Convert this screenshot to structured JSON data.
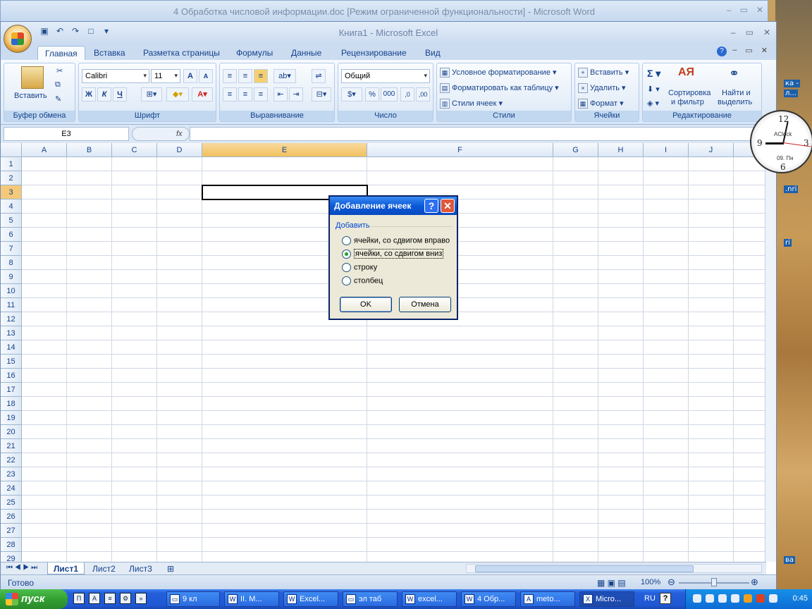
{
  "word": {
    "title": "4 Обработка числовой информации.doc [Режим ограниченной функциональности] - Microsoft Word"
  },
  "excel": {
    "title": "Книга1 - Microsoft Excel"
  },
  "tabs": [
    "Главная",
    "Вставка",
    "Разметка страницы",
    "Формулы",
    "Данные",
    "Рецензирование",
    "Вид"
  ],
  "ribbon": {
    "clipboard": {
      "label": "Буфер обмена",
      "paste": "Вставить"
    },
    "font": {
      "label": "Шрифт",
      "name": "Calibri",
      "size": "11",
      "bold": "Ж",
      "italic": "К",
      "underline": "Ч"
    },
    "align": {
      "label": "Выравнивание"
    },
    "number": {
      "label": "Число",
      "format": "Общий",
      "percent": "%",
      "thousands": "000"
    },
    "styles": {
      "label": "Стили",
      "cond": "Условное форматирование",
      "table": "Форматировать как таблицу",
      "cell": "Стили ячеек"
    },
    "cells": {
      "label": "Ячейки",
      "insert": "Вставить",
      "delete": "Удалить",
      "format": "Формат"
    },
    "edit": {
      "label": "Редактирование",
      "sigma": "Σ",
      "sort": "Сортировка",
      "sort2": "и фильтр",
      "find": "Найти и",
      "find2": "выделить"
    }
  },
  "formula_bar": {
    "namebox": "E3",
    "fx": "fx"
  },
  "columns": [
    "A",
    "B",
    "C",
    "D",
    "E",
    "F",
    "G",
    "H",
    "I",
    "J"
  ],
  "rows": [
    "1",
    "2",
    "3",
    "4",
    "5",
    "6",
    "7",
    "8",
    "9",
    "10",
    "11",
    "12",
    "13",
    "14",
    "15",
    "16",
    "17",
    "18",
    "19",
    "20",
    "21",
    "22",
    "23",
    "24",
    "25",
    "26",
    "27",
    "28",
    "29"
  ],
  "sheets": [
    "Лист1",
    "Лист2",
    "Лист3"
  ],
  "status": {
    "ready": "Готово",
    "zoom": "100%"
  },
  "dialog": {
    "title": "Добавление ячеек",
    "group": "Добавить",
    "options": [
      "ячейки, со сдвигом вправо",
      "ячейки, со сдвигом вниз",
      "строку",
      "столбец"
    ],
    "selected": 1,
    "ok": "OK",
    "cancel": "Отмена"
  },
  "clock": {
    "brand": "AClock",
    "date": "09. Пн"
  },
  "desktop_labels": [
    "ка -",
    "л...",
    ".nri",
    "ri",
    "ва"
  ],
  "taskbar": {
    "start": "пуск",
    "items": [
      "9 кл",
      "II. М...",
      "Excel...",
      "эл таб",
      "excel...",
      "4 Обр...",
      "meto...",
      "Micro..."
    ],
    "lang": "RU",
    "time": "0:45"
  }
}
